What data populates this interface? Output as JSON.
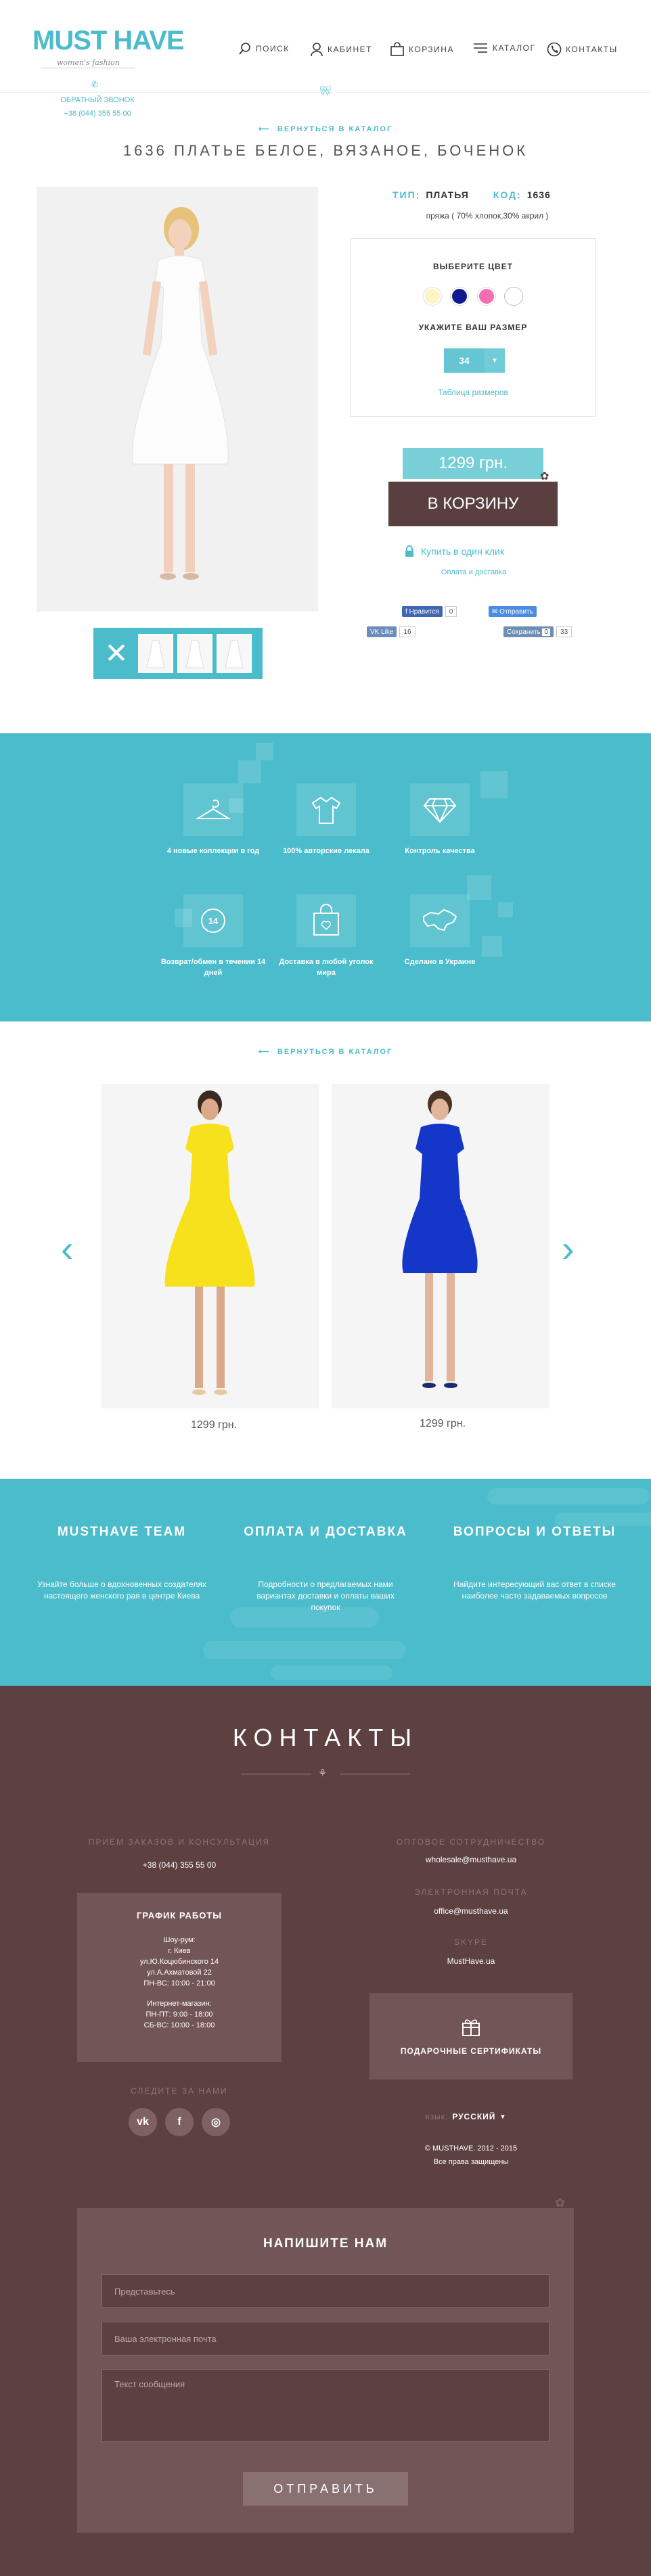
{
  "header": {
    "logo": "MUST HAVE",
    "logo_sub": "women's fashion",
    "callback": "ОБРАТНЫЙ ЗВОНОК",
    "phone": "+38 (044) 355 55 00",
    "nav": [
      {
        "label": "ПОИСК",
        "icon": "search-icon"
      },
      {
        "label": "КАБИНЕТ",
        "icon": "user-icon"
      },
      {
        "label": "КОРЗИНА",
        "icon": "bag-icon"
      },
      {
        "label": "КАТАЛОГ",
        "icon": "menu-icon"
      },
      {
        "label": "КОНТАКТЫ",
        "icon": "phone-icon"
      }
    ]
  },
  "product": {
    "back_link": "ВЕРНУТЬСЯ В КАТАЛОГ",
    "title": "1636 ПЛАТЬЕ БЕЛОЕ, ВЯЗАНОЕ, БОЧЕНОК",
    "type_label": "ТИП:",
    "type_value": "ПЛАТЬЯ",
    "code_label": "КОД:",
    "code_value": "1636",
    "fabric": "пряжа ( 70% хлопок,30% акрил )",
    "choose_color": "ВЫБЕРИТЕ ЦВЕТ",
    "colors": [
      "#fbf5c4",
      "#0f1a8f",
      "#f46fb2",
      "#ffffff"
    ],
    "choose_size": "УКАЖИТЕ ВАШ РАЗМЕР",
    "size": "34",
    "size_table": "Таблица размеров",
    "price": "1299 грн.",
    "cart": "В КОРЗИНУ",
    "one_click": "Купить в один клик",
    "delivery": "Оплата и доставка",
    "social": {
      "fb_like": "Нравится",
      "fb_count": "0",
      "send": "Отправить",
      "vk_like": "Like",
      "vk_count": "16",
      "save": "Сохранить",
      "save_count_a": "0",
      "save_count_b": "33"
    }
  },
  "features": [
    {
      "icon": "hanger-icon",
      "text": "4 новые коллекции в год"
    },
    {
      "icon": "shirt-icon",
      "text": "100% авторские лекала"
    },
    {
      "icon": "diamond-icon",
      "text": "Контроль качества"
    },
    {
      "icon": "return-14-icon",
      "text": "Возврат/обмен в течении 14 дней"
    },
    {
      "icon": "shopping-bag-heart-icon",
      "text": "Доставка в любой уголок мира"
    },
    {
      "icon": "ukraine-map-icon",
      "text": "Сделано в Украине"
    }
  ],
  "carousel": {
    "back_link": "ВЕРНУТЬСЯ В КАТАЛОГ",
    "items": [
      {
        "price": "1299 грн.",
        "color": "#f7e01c"
      },
      {
        "price": "1299 грн.",
        "color": "#1437c9"
      }
    ]
  },
  "info": [
    {
      "title": "MUSTHAVE TEAM",
      "text": "Узнайте больше о вдохновенных создателях настоящего женского рая в центре Киева"
    },
    {
      "title": "ОПЛАТА И ДОСТАВКА",
      "text": "Подробности о предлагаемых нами вариантах доставки и оплаты ваших покупок"
    },
    {
      "title": "ВОПРОСЫ И ОТВЕТЫ",
      "text": "Найдите интересующий вас ответ в списке наиболее часто задаваемых вопросов"
    }
  ],
  "contacts": {
    "title": "КОНТАКТЫ",
    "orders_label": "ПРИЕМ ЗАКАЗОВ И КОНСУЛЬТАЦИЯ",
    "orders_phone": "+38 (044) 355 55 00",
    "schedule_title": "ГРАФИК РАБОТЫ",
    "showroom": [
      "Шоу-рум:",
      "г. Киев",
      "ул.Ю.Коцюбинского 14",
      "ул.А.Ахматовой 22",
      "ПН-ВС: 10:00 - 21:00"
    ],
    "eshop": [
      "Интернет-магазин:",
      "ПН-ПТ: 9:00 - 18:00",
      "СБ-ВС: 10:00 - 18:00"
    ],
    "follow": "СЛЕДИТЕ ЗА НАМИ",
    "wholesale_label": "ОПТОВОЕ СОТРУДНИЧЕСТВО",
    "wholesale_email": "wholesale@musthave.ua",
    "email_label": "ЭЛЕКТРОННАЯ ПОЧТА",
    "email": "office@musthave.ua",
    "skype_label": "SKYPE",
    "skype": "MustHave.ua",
    "gift": "ПОДАРОЧНЫЕ СЕРТИФИКАТЫ",
    "lang_label": "язык:",
    "lang": "РУССКИЙ",
    "copyright": "© MUSTHAVE. 2012 - 2015",
    "rights": "Все права защищены"
  },
  "form": {
    "title": "НАПИШИТЕ НАМ",
    "name_ph": "Представьтесь",
    "email_ph": "Ваша электронная почта",
    "msg_ph": "Текст сообщения",
    "submit": "ОТПРАВИТЬ"
  }
}
